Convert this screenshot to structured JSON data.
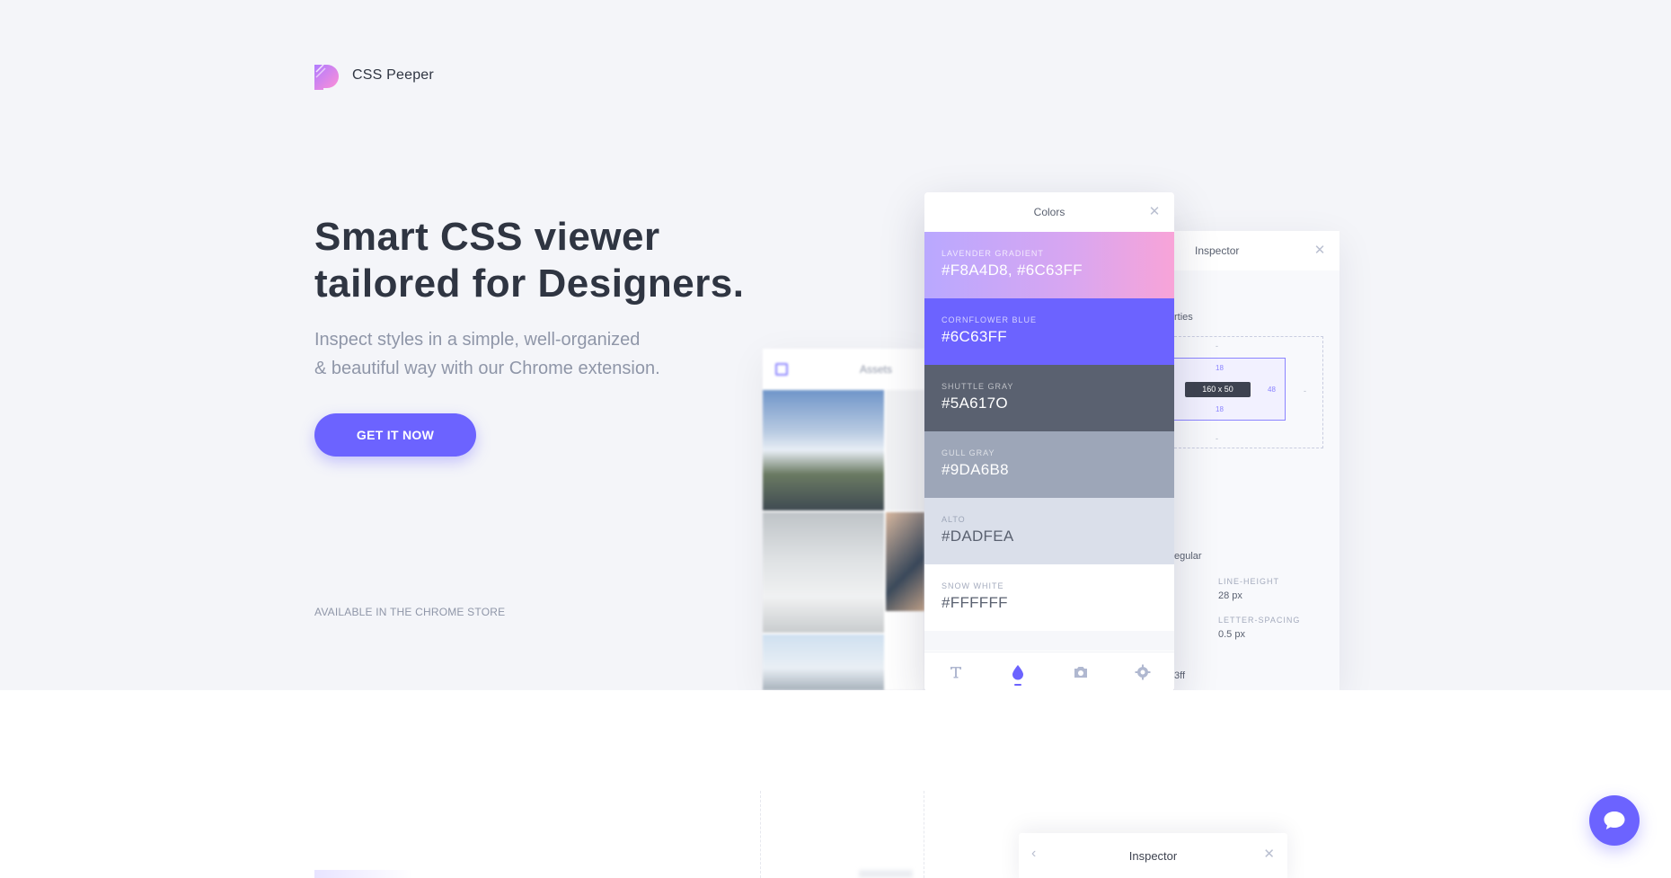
{
  "brand": {
    "name": "CSS Peeper"
  },
  "hero": {
    "headline_line1": "Smart CSS viewer",
    "headline_line2": "tailored for Designers.",
    "sub_line1": "Inspect styles in a simple, well-organized",
    "sub_line2": "& beautiful way with our Chrome extension.",
    "cta_label": "GET IT NOW",
    "store_note": "AVAILABLE IN THE CHROME STORE"
  },
  "assets_panel": {
    "title": "Assets"
  },
  "colors_panel": {
    "title": "Colors",
    "swatches": [
      {
        "name": "LAVENDER GRADIENT",
        "value": "#F8A4D8, #6C63FF"
      },
      {
        "name": "CORNFLOWER BLUE",
        "value": "#6C63FF"
      },
      {
        "name": "SHUTTLE GRAY",
        "value": "#5A617O"
      },
      {
        "name": "GULL GRAY",
        "value": "#9DA6B8"
      },
      {
        "name": "ALTO",
        "value": "#DADFEA"
      },
      {
        "name": "SNOW WHITE",
        "value": "#FFFFFF"
      }
    ],
    "tabs": [
      {
        "icon": "typography-icon"
      },
      {
        "icon": "color-drop-icon",
        "active": true
      },
      {
        "icon": "camera-icon"
      },
      {
        "icon": "settings-icon"
      }
    ]
  },
  "inspector_panel": {
    "title": "Inspector",
    "properties_label": "rties",
    "box": {
      "top_outer": "-",
      "bottom_outer": "-",
      "right_outer": "-",
      "padding_top": "18",
      "padding_bottom": "18",
      "padding_right": "48",
      "size": "160 x 50"
    },
    "font_weight": "egular",
    "line_height_label": "LINE-HEIGHT",
    "line_height_value": "28 px",
    "letter_spacing_label": "LETTER-SPACING",
    "letter_spacing_value": "0.5 px",
    "color_fragment": "3ff"
  },
  "lower_inspector": {
    "title": "Inspector"
  },
  "colors": {
    "accent": "#6C63FF",
    "hero_bg": "#F4F5F9",
    "heading": "#2F3542",
    "muted": "#8F96A8"
  }
}
